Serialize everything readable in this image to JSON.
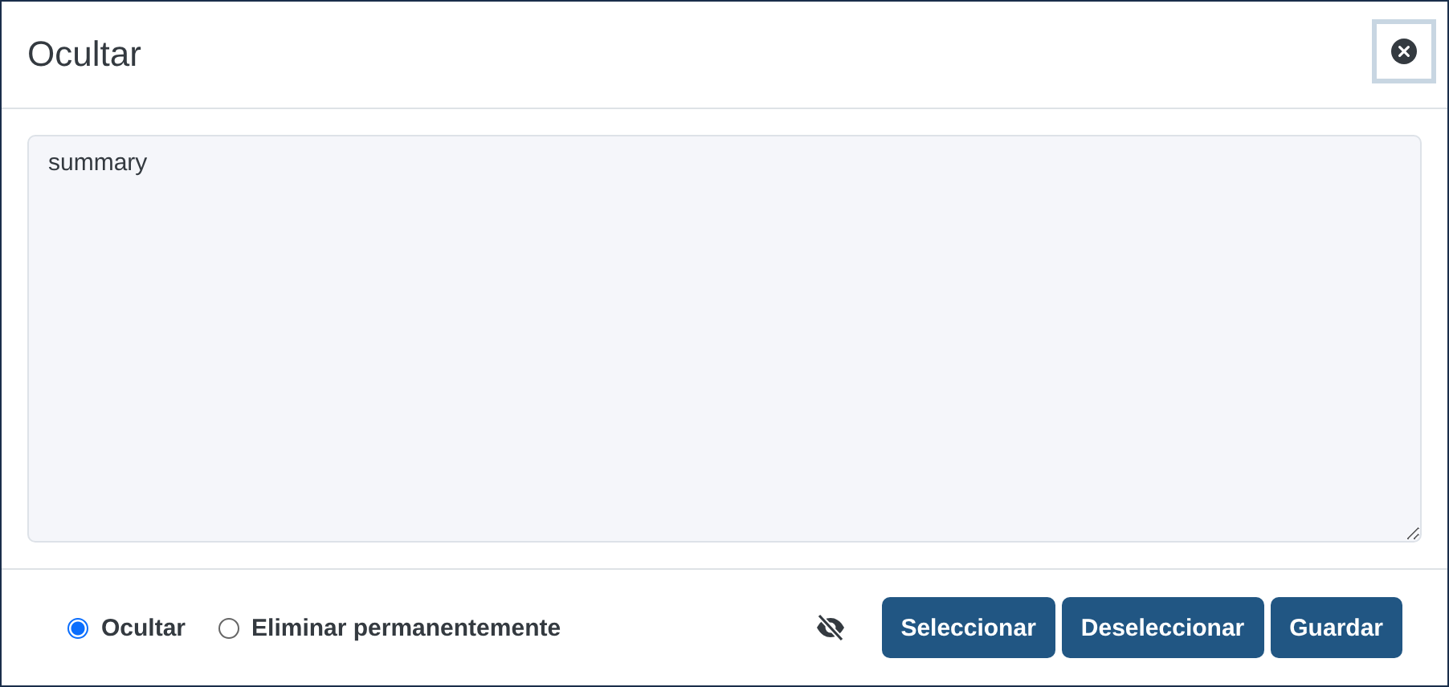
{
  "dialog": {
    "title": "Ocultar"
  },
  "textarea": {
    "value": "summary"
  },
  "options": [
    {
      "label": "Ocultar",
      "selected": true
    },
    {
      "label": "Eliminar permanentemente",
      "selected": false
    }
  ],
  "buttons": [
    "Seleccionar",
    "Deseleccionar",
    "Guardar"
  ]
}
